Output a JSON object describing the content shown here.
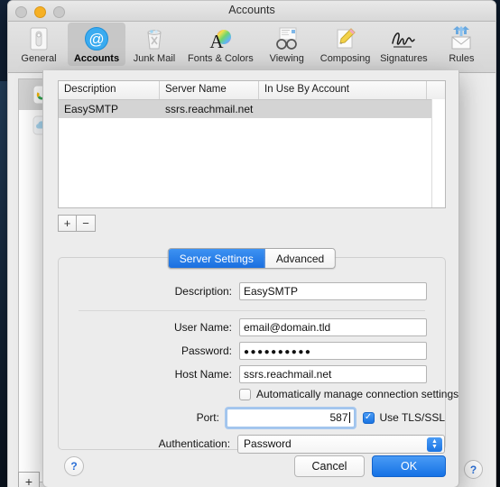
{
  "window": {
    "title": "Accounts",
    "traffic_lights": [
      "close",
      "minimize",
      "zoom"
    ]
  },
  "toolbar": {
    "items": [
      {
        "label": "General",
        "icon": "general-switch-icon",
        "selected": false
      },
      {
        "label": "Accounts",
        "icon": "at-sign-icon",
        "selected": true
      },
      {
        "label": "Junk Mail",
        "icon": "trash-icon",
        "selected": false
      },
      {
        "label": "Fonts & Colors",
        "icon": "font-color-icon",
        "selected": false
      },
      {
        "label": "Viewing",
        "icon": "glasses-icon",
        "selected": false
      },
      {
        "label": "Composing",
        "icon": "pencil-note-icon",
        "selected": false
      },
      {
        "label": "Signatures",
        "icon": "signature-icon",
        "selected": false
      },
      {
        "label": "Rules",
        "icon": "rules-envelope-icon",
        "selected": false
      }
    ]
  },
  "background_window": {
    "accounts": [
      {
        "icon": "google-account-icon",
        "selected": true
      },
      {
        "icon": "icloud-account-icon",
        "selected": false
      }
    ],
    "add_label": "+",
    "help_label": "?"
  },
  "sheet": {
    "table": {
      "columns": [
        "Description",
        "Server Name",
        "In Use By Account"
      ],
      "rows": [
        {
          "description": "EasySMTP",
          "server_name": "ssrs.reachmail.net",
          "in_use_by_account": "",
          "selected": true
        }
      ]
    },
    "list_controls": {
      "add_label": "+",
      "remove_label": "−"
    },
    "tabs": [
      {
        "label": "Server Settings",
        "active": true
      },
      {
        "label": "Advanced",
        "active": false
      }
    ],
    "fields": [
      {
        "label": "Description:",
        "value": "EasySMTP",
        "placeholder": ""
      },
      {
        "label": "User Name:",
        "value": "email@domain.tld",
        "placeholder": ""
      },
      {
        "label": "Password:",
        "value": "●●●●●●●●●●",
        "placeholder": ""
      },
      {
        "label": "Host Name:",
        "value": "ssrs.reachmail.net",
        "placeholder": ""
      }
    ],
    "auto_manage": {
      "label": "Automatically manage connection settings",
      "checked": false
    },
    "port": {
      "label": "Port:",
      "value": "587"
    },
    "tls": {
      "label": "Use TLS/SSL",
      "checked": true,
      "check_glyph": "✓"
    },
    "authentication": {
      "label": "Authentication:",
      "value": "Password"
    },
    "footer": {
      "help_label": "?",
      "cancel_label": "Cancel",
      "ok_label": "OK"
    }
  },
  "colors": {
    "accent_blue": "#1a74e2",
    "selection_gray": "#d4d4d4",
    "window_bg": "#ececec",
    "focus_ring": "#9ec3ec"
  }
}
